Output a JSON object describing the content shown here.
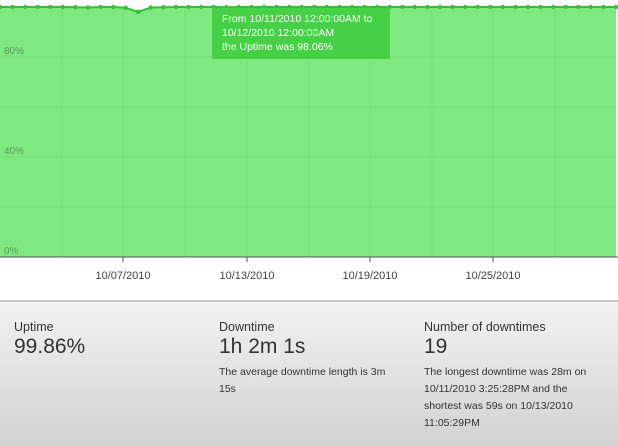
{
  "chart_data": {
    "type": "area",
    "series": [
      {
        "values": [
          100,
          100,
          100,
          100,
          100,
          100,
          99.9,
          99.8,
          100,
          100,
          99.7,
          98.06,
          99.8,
          99.9,
          100,
          100,
          100,
          100,
          99.9,
          100,
          100,
          100,
          100,
          100,
          100,
          100,
          100,
          100,
          100,
          100,
          100,
          100,
          100,
          100,
          100,
          100,
          100,
          100,
          100,
          100,
          100,
          100,
          100,
          100,
          100,
          100,
          100,
          100,
          100,
          100
        ]
      }
    ],
    "ylim": [
      0,
      100
    ],
    "y_ticks": [
      "0%",
      "40%",
      "80%"
    ],
    "x_ticks": [
      "10/07/2010",
      "10/13/2010",
      "10/19/2010",
      "10/25/2010"
    ],
    "grid": true,
    "colors": {
      "fill": "#80e880",
      "line": "#33c233",
      "grid": "#6bd46b"
    }
  },
  "tooltip": {
    "line1": "From 10/11/2010 12:00:00AM to",
    "line2": "10/12/2010 12:00:00AM",
    "line3": "the Uptime was 98.06%"
  },
  "stats": {
    "uptime": {
      "label": "Uptime",
      "value": "99.86%"
    },
    "downtime": {
      "label": "Downtime",
      "value": "1h 2m 1s",
      "note": "The average downtime length is 3m 15s"
    },
    "count": {
      "label": "Number of downtimes",
      "value": "19",
      "note": "The longest downtime was 28m on 10/11/2010 3:25:28PM and the shortest was 59s on 10/13/2010 11:05:29PM"
    }
  }
}
